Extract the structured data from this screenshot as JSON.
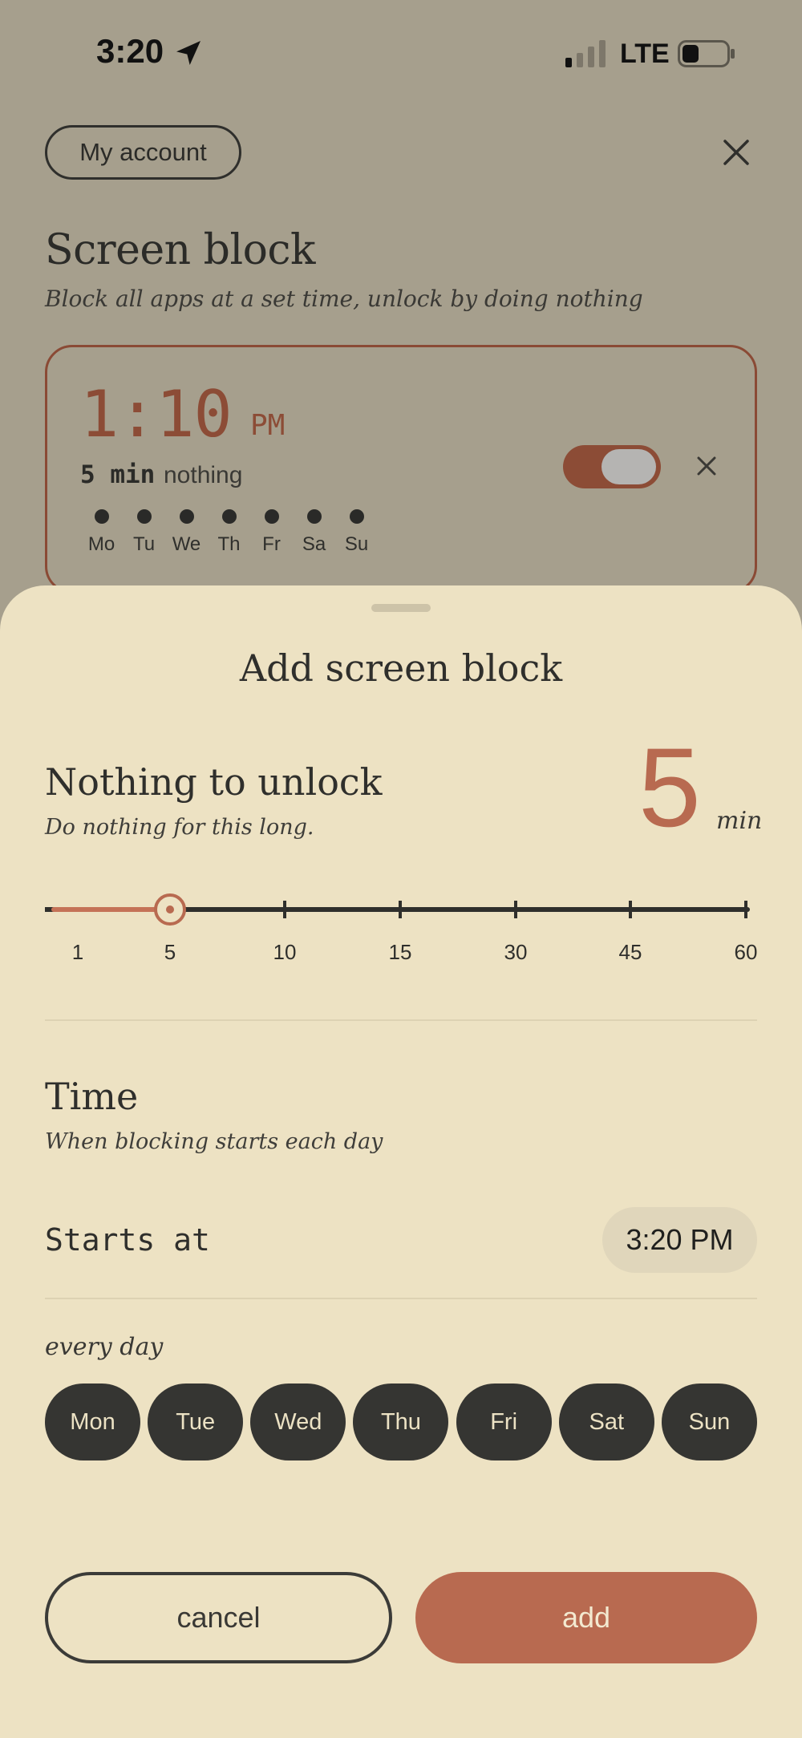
{
  "status_bar": {
    "time": "3:20",
    "network": "LTE",
    "location_icon": "location-arrow-icon",
    "signal_icon": "signal-bars-icon",
    "battery_icon": "battery-icon"
  },
  "header": {
    "account_label": "My account",
    "close_icon": "close-icon"
  },
  "screen": {
    "title": "Screen block",
    "subtitle": "Block all apps at a set time, unlock by doing nothing"
  },
  "existing_block": {
    "time": "1:10",
    "ampm": "PM",
    "duration": "5 min",
    "duration_suffix": "nothing",
    "days": [
      "Mo",
      "Tu",
      "We",
      "Th",
      "Fr",
      "Sa",
      "Su"
    ],
    "enabled": true
  },
  "sheet": {
    "title": "Add screen block",
    "unlock": {
      "title": "Nothing to unlock",
      "subtitle": "Do nothing for this long.",
      "value": "5",
      "unit": "min",
      "slider": {
        "stops": [
          "1",
          "5",
          "10",
          "15",
          "30",
          "45",
          "60"
        ],
        "selected_index": 1
      }
    },
    "time": {
      "title": "Time",
      "subtitle": "When blocking starts each day",
      "starts_label": "Starts at",
      "starts_value": "3:20 PM",
      "repeat_label": "every day",
      "days": [
        "Mon",
        "Tue",
        "Wed",
        "Thu",
        "Fri",
        "Sat",
        "Sun"
      ]
    },
    "cancel_label": "cancel",
    "add_label": "add"
  },
  "colors": {
    "accent": "#b86a50",
    "card_accent": "#8c4c36",
    "sheet_bg": "#ede2c3",
    "dim_bg": "#a69f8d",
    "dark": "#353532"
  }
}
